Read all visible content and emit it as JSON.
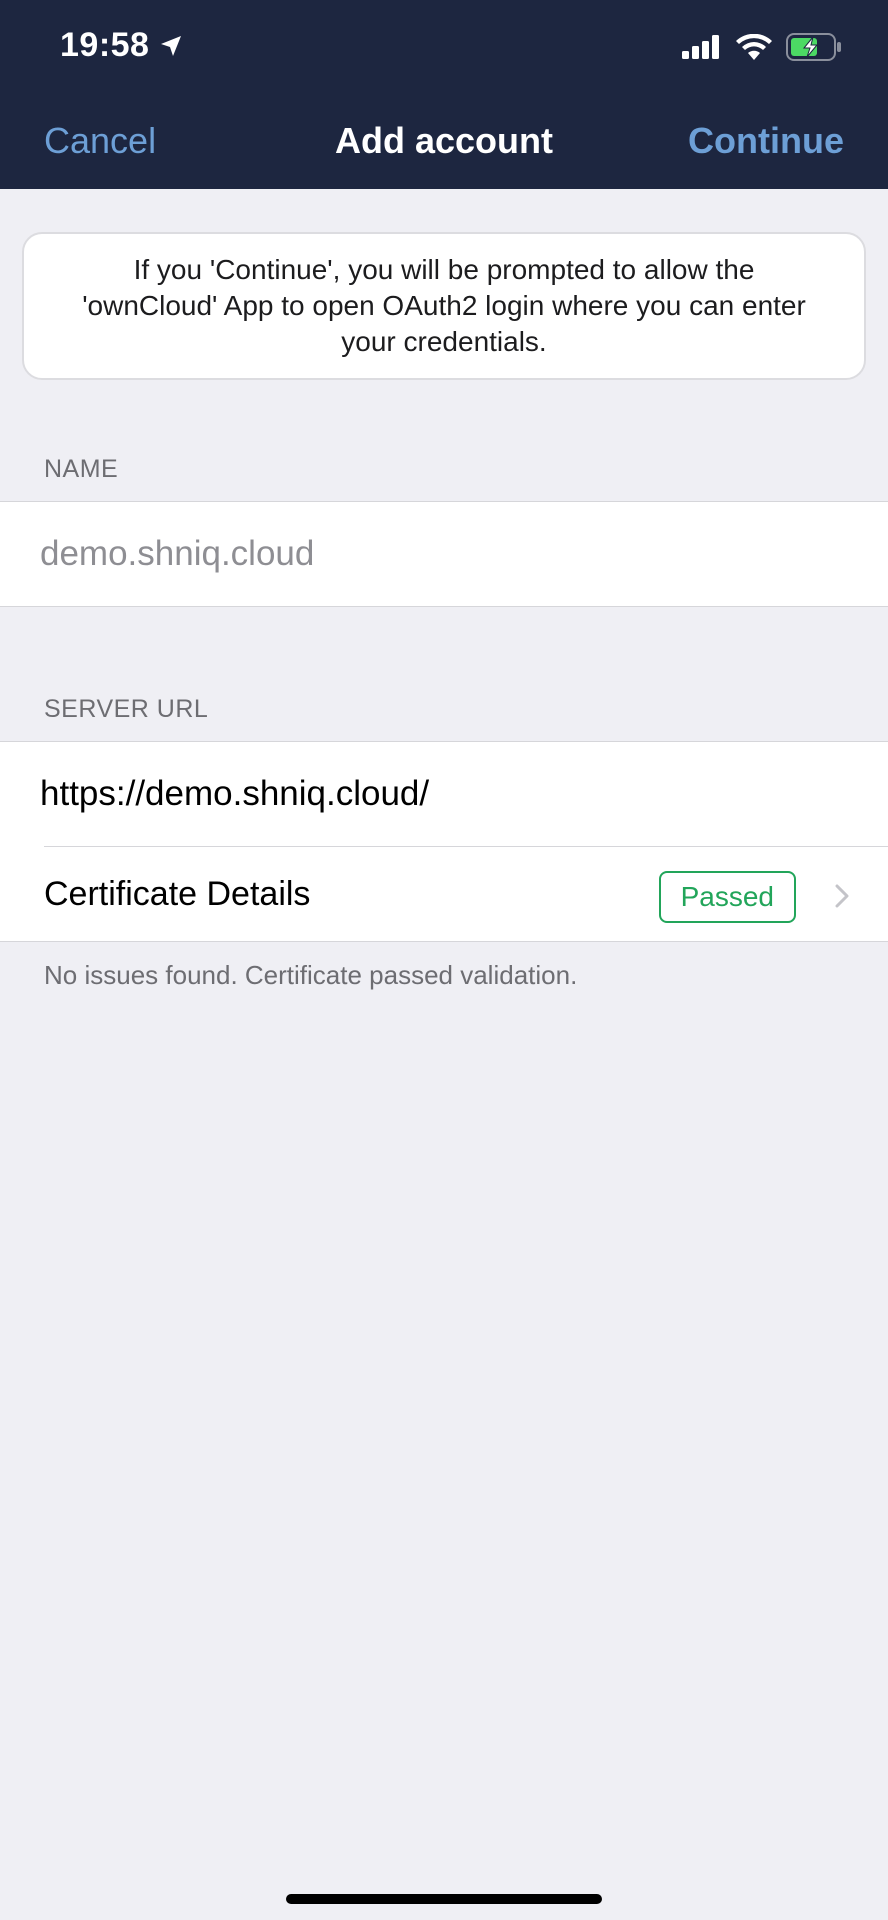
{
  "status_bar": {
    "time": "19:58",
    "location_icon": "location-arrow-icon",
    "signal_icon": "cellular-signal-icon",
    "wifi_icon": "wifi-icon",
    "battery_icon": "battery-charging-icon"
  },
  "nav": {
    "cancel_label": "Cancel",
    "title": "Add account",
    "continue_label": "Continue"
  },
  "info_message": "If you 'Continue', you will be prompted to allow the 'ownCloud' App to open OAuth2 login where you can enter your credentials.",
  "name_section": {
    "header": "NAME",
    "placeholder": "demo.shniq.cloud",
    "value": ""
  },
  "server_section": {
    "header": "SERVER URL",
    "url_value": "https://demo.shniq.cloud/",
    "certificate_label": "Certificate Details",
    "certificate_status": "Passed",
    "footer": "No issues found. Certificate passed validation."
  },
  "colors": {
    "nav_background": "#1d2640",
    "nav_accent": "#6d9fd6",
    "page_background": "#efeff4",
    "passed_green": "#22a55a",
    "battery_green": "#4cd964"
  }
}
